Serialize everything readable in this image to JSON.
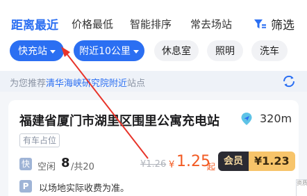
{
  "sort_tabs": [
    "距离最近",
    "价格最低",
    "智能排序",
    "常去场站"
  ],
  "filter": {
    "label": "筛选",
    "icon": "filter-icon"
  },
  "chips": [
    {
      "label": "快充站",
      "selected": true,
      "dropdown": true
    },
    {
      "label": "附近10公里",
      "selected": true,
      "dropdown": true
    },
    {
      "label": "休息室",
      "selected": false,
      "dropdown": false
    },
    {
      "label": "照明",
      "selected": false,
      "dropdown": false
    },
    {
      "label": "洗车",
      "selected": false,
      "dropdown": false
    }
  ],
  "notice": {
    "prefix": "为您推荐",
    "highlight": "清华海峡研究院附近",
    "suffix": "站点",
    "icon": "refresh-icon"
  },
  "station": {
    "name": "福建省厦门市湖里区围里公寓充电站",
    "distance": "320m",
    "tag": "有车占位",
    "fast_icon_text": "快",
    "idle_label": "空闲",
    "idle_count": "8",
    "total": "/共20",
    "old_price": "¥1.26",
    "price_symbol": "¥",
    "price": "1.25",
    "price_suffix": "起",
    "member_label": "会员",
    "member_price": "¥1.23",
    "parking_icon_text": "P",
    "fee_note": "以场地实际收费为准。"
  },
  "watermark_text": "资质"
}
